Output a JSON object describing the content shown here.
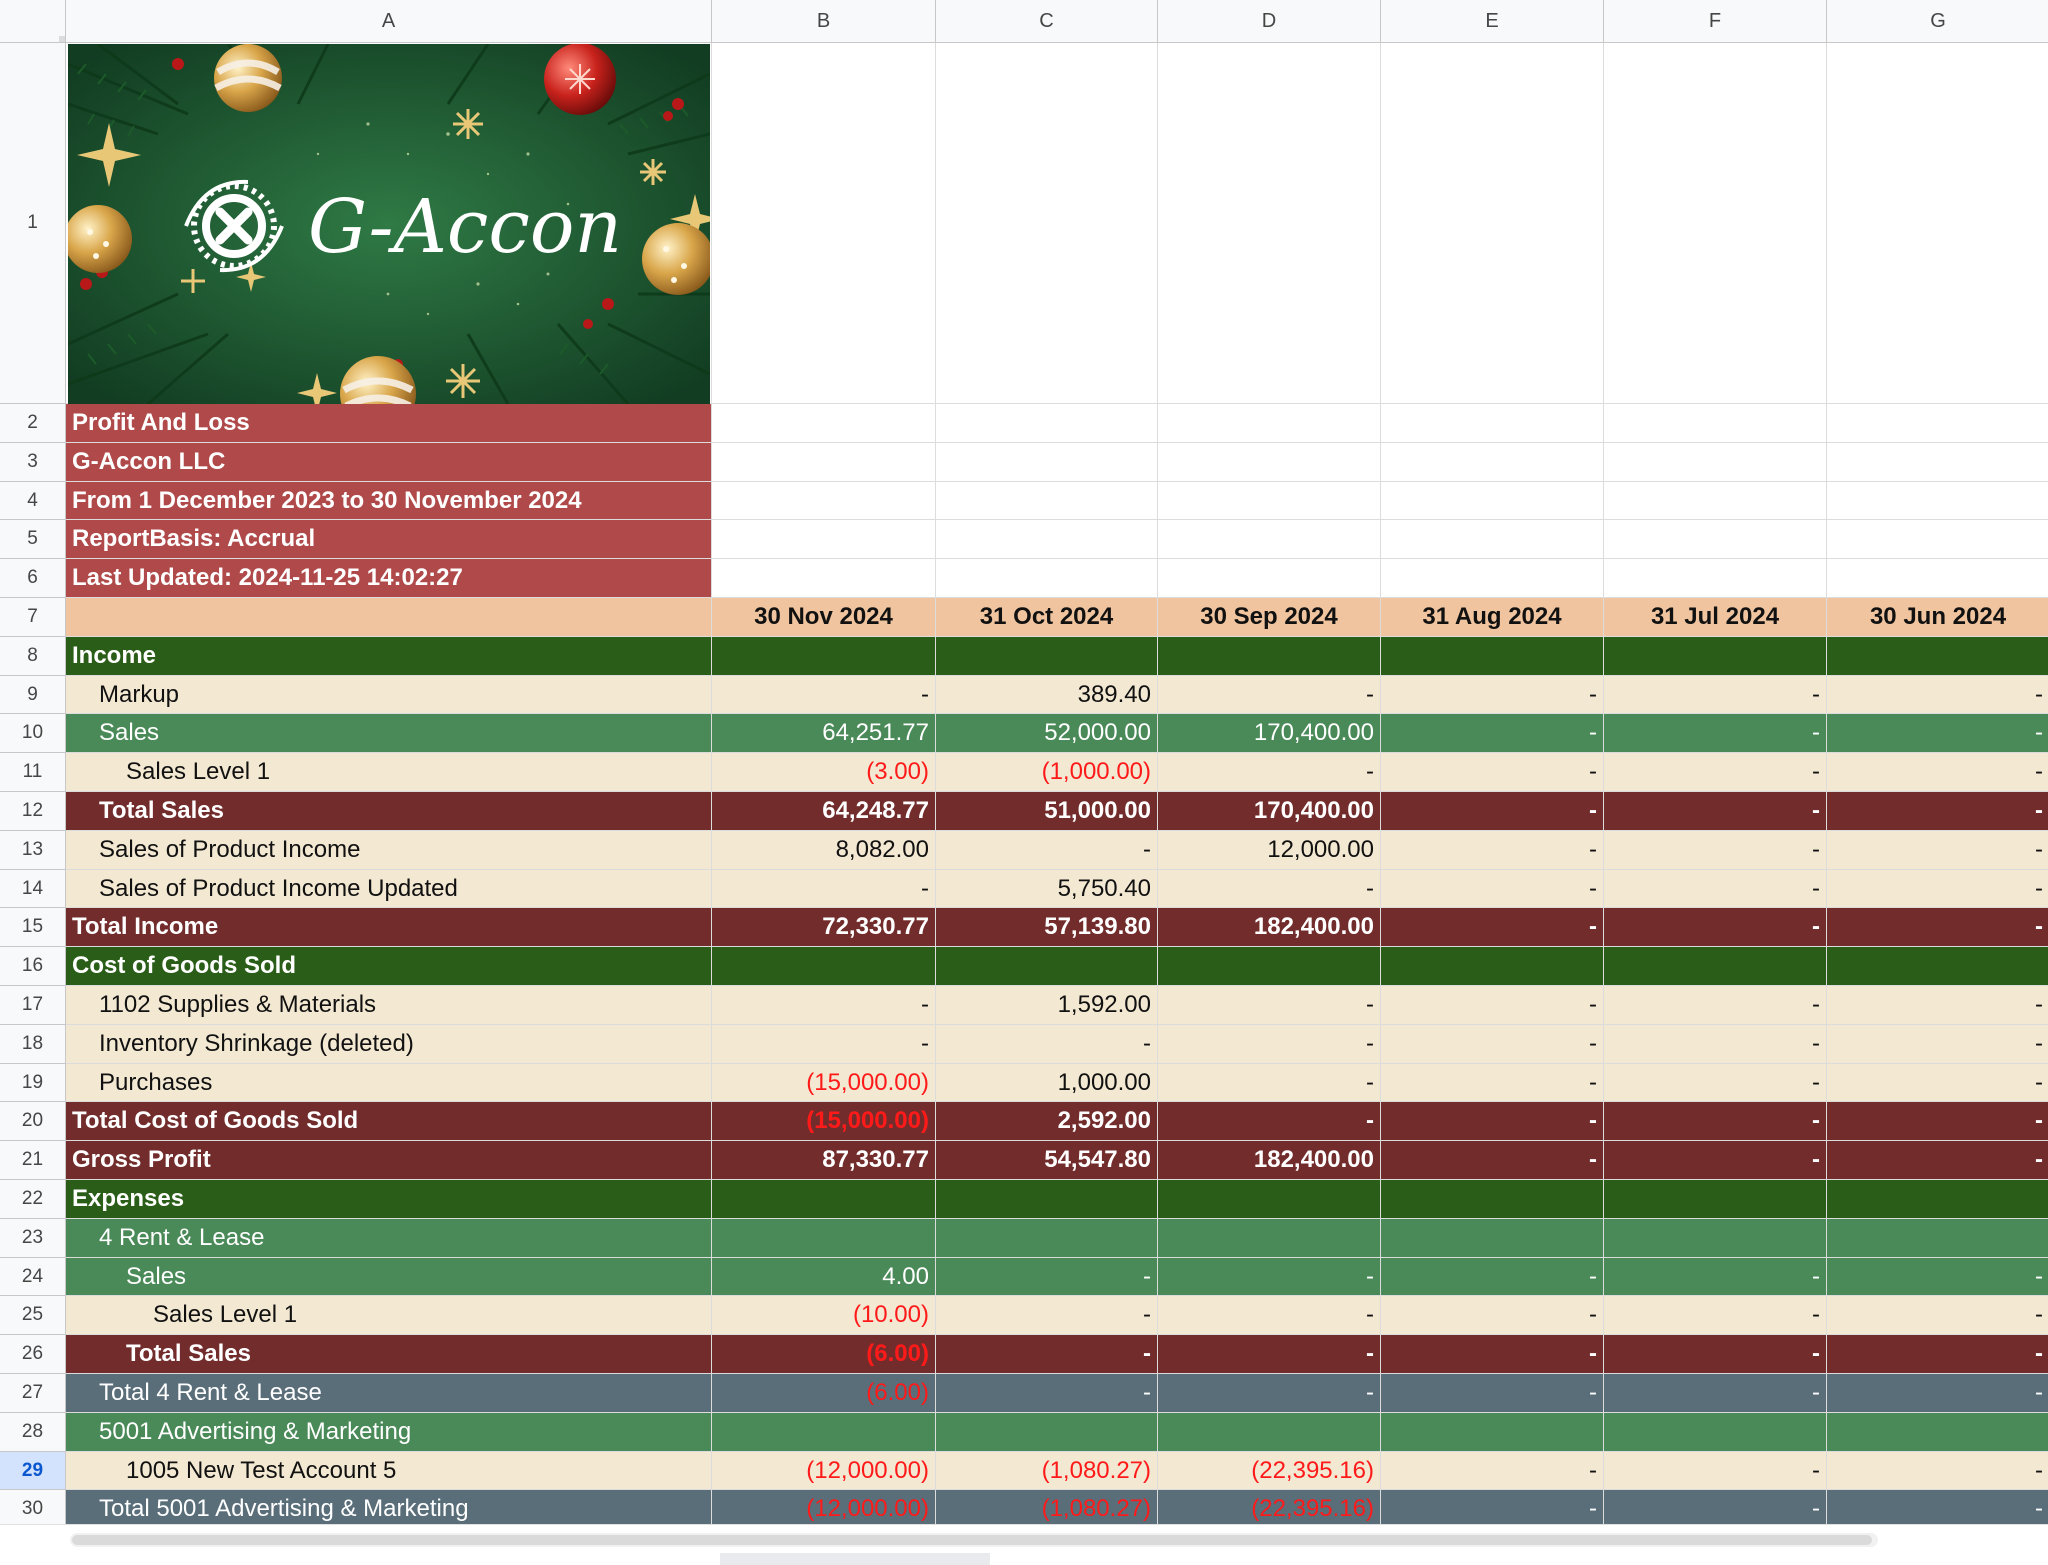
{
  "colors": {
    "title_red": "#b04a4a",
    "header_peach": "#f0c49e",
    "section_green": "#2a5e18",
    "sub_green": "#4a8a58",
    "cream": "#f3e8d2",
    "total_maroon": "#722c2c",
    "slate": "#5a6e7a",
    "negative_red": "#ff1a1a"
  },
  "columns": [
    "A",
    "B",
    "C",
    "D",
    "E",
    "F",
    "G"
  ],
  "banner": {
    "logo_text": "G-Accon",
    "logo_icon": "g-accon-swirl-icon"
  },
  "rows": [
    {
      "n": "1",
      "style": "image",
      "indent": 0,
      "label": "",
      "vals": [
        "",
        "",
        "",
        "",
        "",
        ""
      ]
    },
    {
      "n": "2",
      "style": "title",
      "indent": 0,
      "label": "Profit And Loss",
      "vals": [
        "",
        "",
        "",
        "",
        "",
        ""
      ]
    },
    {
      "n": "3",
      "style": "title",
      "indent": 0,
      "label": "G-Accon LLC",
      "vals": [
        "",
        "",
        "",
        "",
        "",
        ""
      ]
    },
    {
      "n": "4",
      "style": "title",
      "indent": 0,
      "label": "From 1 December 2023 to 30 November 2024",
      "vals": [
        "",
        "",
        "",
        "",
        "",
        ""
      ]
    },
    {
      "n": "5",
      "style": "title",
      "indent": 0,
      "label": "ReportBasis: Accrual",
      "vals": [
        "",
        "",
        "",
        "",
        "",
        ""
      ]
    },
    {
      "n": "6",
      "style": "title",
      "indent": 0,
      "label": "Last Updated: 2024-11-25 14:02:27",
      "vals": [
        "",
        "",
        "",
        "",
        "",
        ""
      ]
    },
    {
      "n": "7",
      "style": "header",
      "indent": 0,
      "label": "",
      "vals": [
        "30 Nov 2024",
        "31 Oct 2024",
        "30 Sep 2024",
        "31 Aug 2024",
        "31 Jul 2024",
        "30 Jun 2024"
      ]
    },
    {
      "n": "8",
      "style": "section",
      "indent": 0,
      "label": "Income",
      "vals": [
        "",
        "",
        "",
        "",
        "",
        ""
      ]
    },
    {
      "n": "9",
      "style": "cream",
      "indent": 1,
      "label": "Markup",
      "vals": [
        "-",
        "389.40",
        "-",
        "-",
        "-",
        "-"
      ]
    },
    {
      "n": "10",
      "style": "green",
      "indent": 1,
      "label": "Sales",
      "vals": [
        "64,251.77",
        "52,000.00",
        "170,400.00",
        "-",
        "-",
        "-"
      ]
    },
    {
      "n": "11",
      "style": "cream",
      "indent": 2,
      "label": "Sales Level 1",
      "vals": [
        "(3.00)",
        "(1,000.00)",
        "-",
        "-",
        "-",
        "-"
      ]
    },
    {
      "n": "12",
      "style": "total",
      "indent": 1,
      "label": "Total Sales",
      "vals": [
        "64,248.77",
        "51,000.00",
        "170,400.00",
        "-",
        "-",
        "-"
      ]
    },
    {
      "n": "13",
      "style": "cream",
      "indent": 1,
      "label": "Sales of Product Income",
      "vals": [
        "8,082.00",
        "-",
        "12,000.00",
        "-",
        "-",
        "-"
      ]
    },
    {
      "n": "14",
      "style": "cream",
      "indent": 1,
      "label": "Sales of Product Income Updated",
      "vals": [
        "-",
        "5,750.40",
        "-",
        "-",
        "-",
        "-"
      ]
    },
    {
      "n": "15",
      "style": "total",
      "indent": 0,
      "label": "Total Income",
      "vals": [
        "72,330.77",
        "57,139.80",
        "182,400.00",
        "-",
        "-",
        "-"
      ]
    },
    {
      "n": "16",
      "style": "section",
      "indent": 0,
      "label": "Cost of Goods Sold",
      "vals": [
        "",
        "",
        "",
        "",
        "",
        ""
      ]
    },
    {
      "n": "17",
      "style": "cream",
      "indent": 1,
      "label": "1102 Supplies & Materials",
      "vals": [
        "-",
        "1,592.00",
        "-",
        "-",
        "-",
        "-"
      ]
    },
    {
      "n": "18",
      "style": "cream",
      "indent": 1,
      "label": "Inventory Shrinkage (deleted)",
      "vals": [
        "-",
        "-",
        "-",
        "-",
        "-",
        "-"
      ]
    },
    {
      "n": "19",
      "style": "cream",
      "indent": 1,
      "label": "Purchases",
      "vals": [
        "(15,000.00)",
        "1,000.00",
        "-",
        "-",
        "-",
        "-"
      ]
    },
    {
      "n": "20",
      "style": "total",
      "indent": 0,
      "label": "Total Cost of Goods Sold",
      "vals": [
        "(15,000.00)",
        "2,592.00",
        "-",
        "-",
        "-",
        "-"
      ]
    },
    {
      "n": "21",
      "style": "total",
      "indent": 0,
      "label": "Gross Profit",
      "vals": [
        "87,330.77",
        "54,547.80",
        "182,400.00",
        "-",
        "-",
        "-"
      ]
    },
    {
      "n": "22",
      "style": "section",
      "indent": 0,
      "label": "Expenses",
      "vals": [
        "",
        "",
        "",
        "",
        "",
        ""
      ]
    },
    {
      "n": "23",
      "style": "green",
      "indent": 1,
      "label": "4 Rent & Lease",
      "vals": [
        "",
        "",
        "",
        "",
        "",
        ""
      ]
    },
    {
      "n": "24",
      "style": "green",
      "indent": 2,
      "label": "Sales",
      "vals": [
        "4.00",
        "-",
        "-",
        "-",
        "-",
        "-"
      ]
    },
    {
      "n": "25",
      "style": "cream",
      "indent": 3,
      "label": "Sales Level 1",
      "vals": [
        "(10.00)",
        "-",
        "-",
        "-",
        "-",
        "-"
      ]
    },
    {
      "n": "26",
      "style": "total",
      "indent": 2,
      "label": "Total Sales",
      "vals": [
        "(6.00)",
        "-",
        "-",
        "-",
        "-",
        "-"
      ]
    },
    {
      "n": "27",
      "style": "slate",
      "indent": 1,
      "label": "Total 4 Rent & Lease",
      "vals": [
        "(6.00)",
        "-",
        "-",
        "-",
        "-",
        "-"
      ]
    },
    {
      "n": "28",
      "style": "green",
      "indent": 1,
      "label": "5001 Advertising & Marketing",
      "vals": [
        "",
        "",
        "",
        "",
        "",
        ""
      ]
    },
    {
      "n": "29",
      "style": "cream",
      "indent": 2,
      "label": "1005 New Test Account 5",
      "vals": [
        "(12,000.00)",
        "(1,080.27)",
        "(22,395.16)",
        "-",
        "-",
        "-"
      ]
    },
    {
      "n": "30",
      "style": "slate",
      "indent": 1,
      "label": "Total 5001 Advertising & Marketing",
      "vals": [
        "(12,000.00)",
        "(1,080.27)",
        "(22,395.16)",
        "-",
        "-",
        "-"
      ]
    }
  ],
  "selected_row": "29"
}
